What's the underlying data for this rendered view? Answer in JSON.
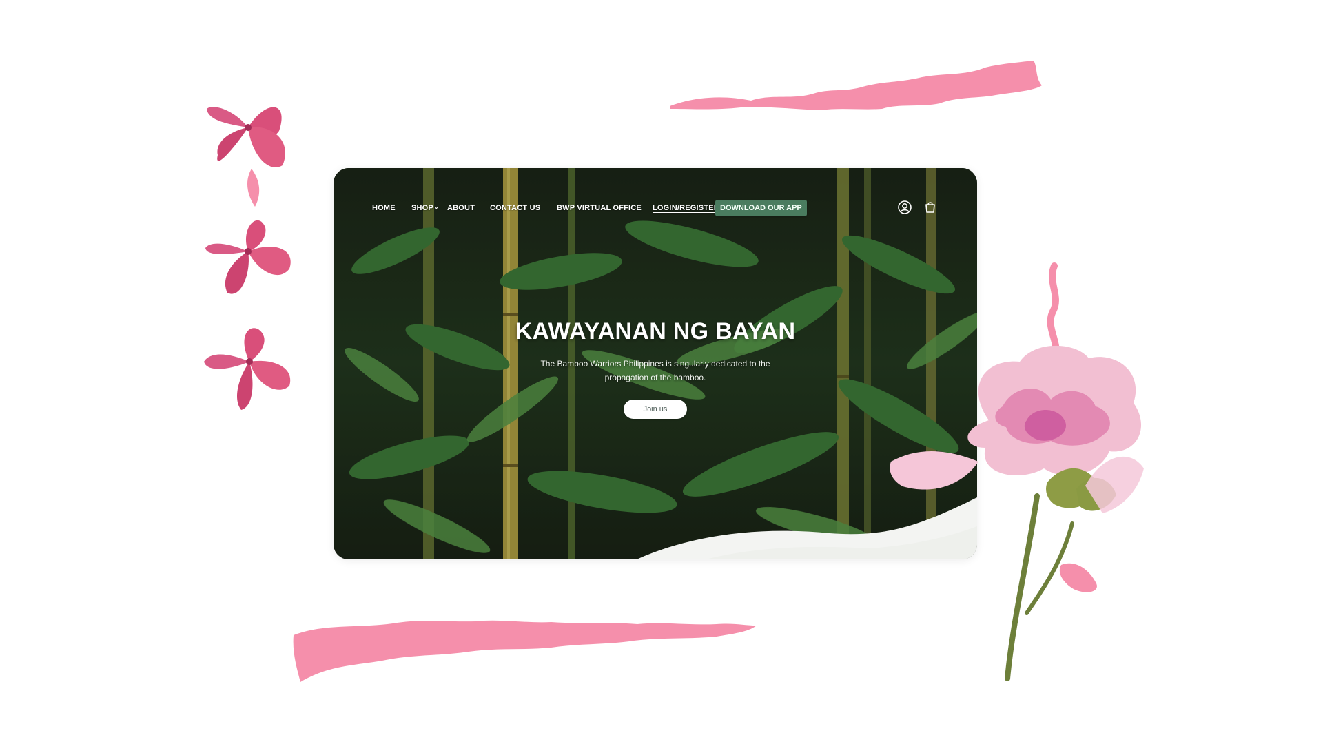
{
  "nav": {
    "home": "HOME",
    "shop": "SHOP",
    "about": "ABOUT",
    "contact": "CONTACT US",
    "office": "BWP VIRTUAL OFFICE",
    "login": "LOGIN/REGISTER",
    "download": "DOWNLOAD OUR APP",
    "icons": [
      "user-icon",
      "cart-icon",
      "chevron-down-icon"
    ]
  },
  "hero": {
    "title": "KAWAYANAN NG BAYAN",
    "subtitle": "The Bamboo Warriors Philippines is singularly dedicated to the propagation of the bamboo.",
    "cta": "Join us"
  },
  "colors": {
    "accent": "#4a7c5f",
    "decor_pink": "#f58fab",
    "petal_pink": "#d94f7a",
    "foliage_dark": "#1f2b1d",
    "foliage_green": "#3f7d3a",
    "wave_white": "#f3f4f2"
  }
}
